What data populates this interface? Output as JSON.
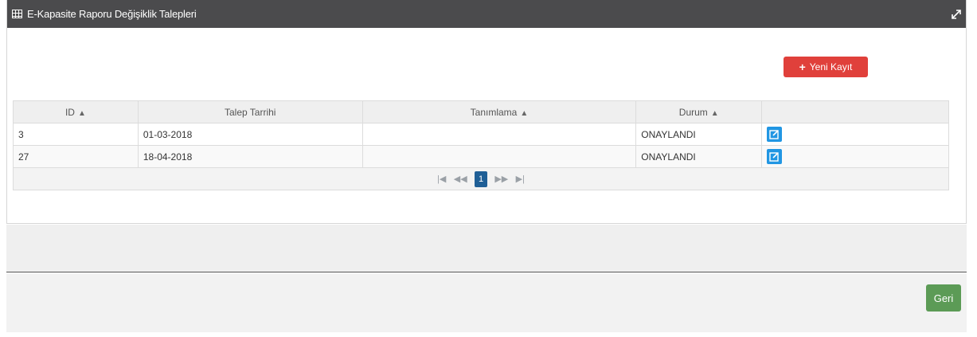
{
  "panel": {
    "title": "E-Kapasite Raporu Değişiklik Talepleri"
  },
  "actions": {
    "new_label": "Yeni Kayıt",
    "back_label": "Geri"
  },
  "table": {
    "columns": [
      {
        "label": "ID",
        "sortable": true
      },
      {
        "label": "Talep Tarrihi",
        "sortable": false
      },
      {
        "label": "Tanımlama",
        "sortable": true
      },
      {
        "label": "Durum",
        "sortable": true
      },
      {
        "label": "",
        "sortable": false
      }
    ],
    "rows": [
      {
        "id": "3",
        "date": "01-03-2018",
        "description": "",
        "status": "ONAYLANDI"
      },
      {
        "id": "27",
        "date": "18-04-2018",
        "description": "",
        "status": "ONAYLANDI"
      }
    ]
  },
  "pager": {
    "current_page": "1"
  },
  "colors": {
    "header_bg": "#4b4b4d",
    "new_button": "#e0403b",
    "edit_button": "#2196e3",
    "back_button": "#5c9b56",
    "active_page": "#1f5f96"
  },
  "icons": {
    "header": "table-grid-icon",
    "expand": "expand-icon",
    "edit": "edit-icon",
    "sort": "sort-icon"
  }
}
